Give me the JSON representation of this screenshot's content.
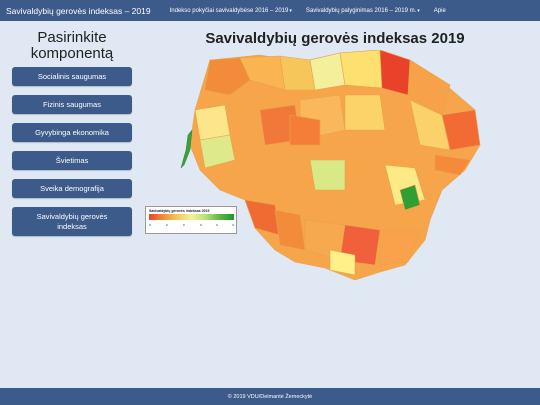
{
  "navbar": {
    "brand": "Savivaldybių gerovės indeksas – 2019",
    "links": [
      "Indekso pokyčiai savivaldybėse 2016 – 2019",
      "Savivaldybių palyginimas 2016 – 2019 m.",
      "Apie"
    ],
    "caret": "▾"
  },
  "sidebar": {
    "title": "Pasirinkite komponentą",
    "buttons": [
      "Socialinis saugumas",
      "Fizinis saugumas",
      "Gyvybinga ekonomika",
      "Švietimas",
      "Sveika demografija",
      "Savivaldybių gerovės indeksas"
    ]
  },
  "map": {
    "title": "Savivaldybių gerovės indeksas 2019",
    "legend_title": "Savivaldybių gerovės indeksas 2019",
    "legend_ticks": [
      "0",
      "0",
      "0",
      "0",
      "0",
      "0"
    ],
    "colors": {
      "low": "#e8432a",
      "mid": "#f7c65a",
      "high": "#1e9a2a"
    }
  },
  "footer": {
    "text": "© 2019 VDU/Deimantė Žemeckytė"
  }
}
